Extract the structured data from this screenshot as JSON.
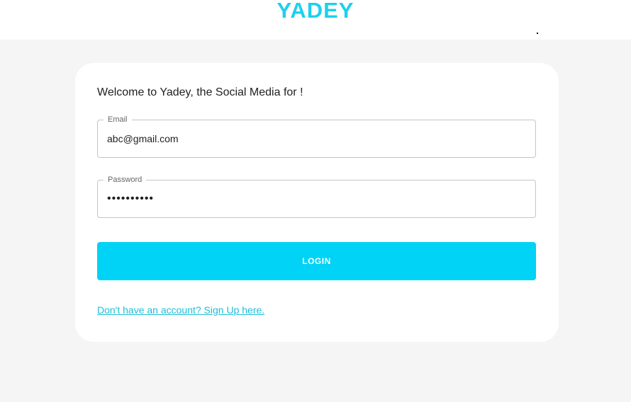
{
  "header": {
    "logo_text": "YADEY",
    "brand_color": "#1bd1ee"
  },
  "login_card": {
    "welcome_text": "Welcome to Yadey, the Social Media for !",
    "email": {
      "label": "Email",
      "value": "abc@gmail.com"
    },
    "password": {
      "label": "Password",
      "value": "••••••••••"
    },
    "login_button_label": "LOGIN",
    "login_button_color": "#00d3f5",
    "signup_link_text": "Don't have an account? Sign Up here."
  }
}
